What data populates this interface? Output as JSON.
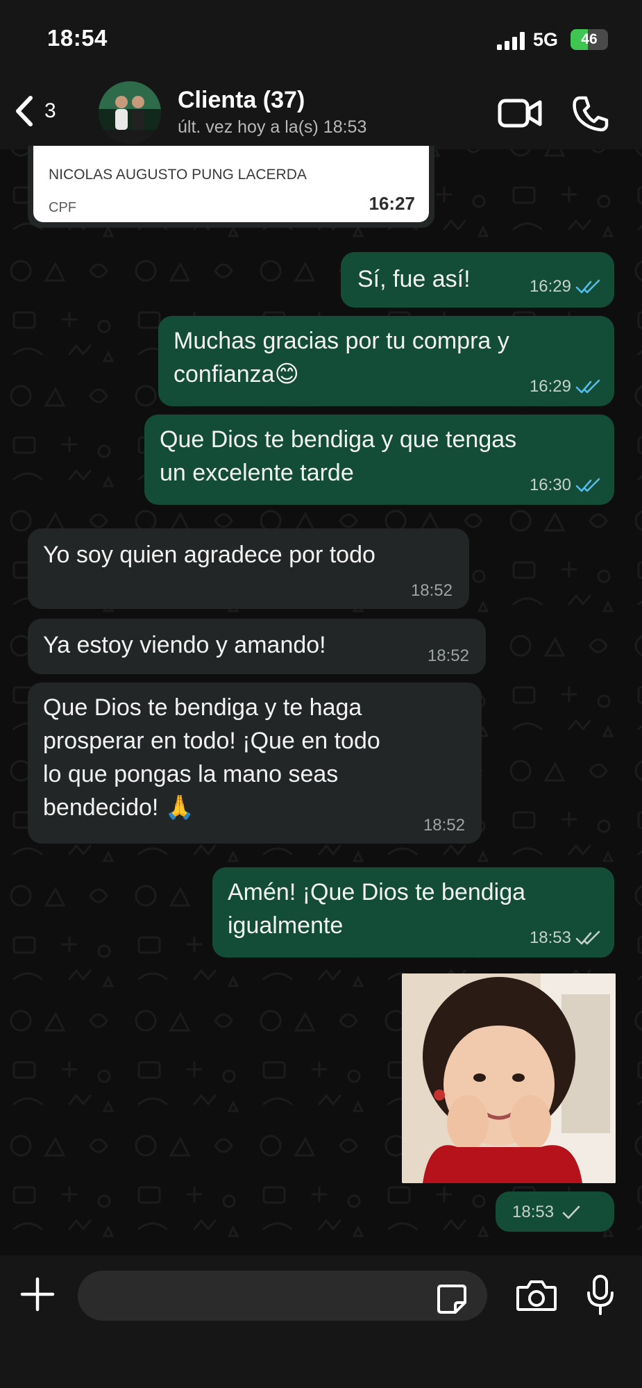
{
  "status_bar": {
    "time": "18:54",
    "network": "5G",
    "battery": "46",
    "battery_level": 0.46
  },
  "header": {
    "back_count": "3",
    "contact_name": "Clienta (37)",
    "last_seen": "últ. vez hoy a la(s) 18:53"
  },
  "forwarded_card": {
    "name": "NICOLAS AUGUSTO PUNG LACERDA",
    "label": "CPF",
    "time": "16:27"
  },
  "messages": [
    {
      "dir": "out",
      "text": "Sí, fue así!",
      "time": "16:29",
      "status": "read"
    },
    {
      "dir": "out",
      "text": "Muchas gracias por tu compra y confianza😊",
      "time": "16:29",
      "status": "read"
    },
    {
      "dir": "out",
      "text": "Que Dios te bendiga y que tengas un excelente tarde",
      "time": "16:30",
      "status": "read"
    },
    {
      "dir": "in",
      "text": "Yo soy quien agradece por todo",
      "time": "18:52"
    },
    {
      "dir": "in",
      "text": "Ya estoy viendo y amando!",
      "time": "18:52"
    },
    {
      "dir": "in",
      "text": "Que Dios te bendiga y te haga prosperar en todo! ¡Que en todo lo que pongas la mano seas bendecido! 🙏",
      "time": "18:52"
    },
    {
      "dir": "out",
      "text": "Amén! ¡Que Dios te bendiga igualmente",
      "time": "18:53",
      "status": "delivered"
    },
    {
      "dir": "out",
      "type": "image",
      "time": "18:53",
      "status": "sent"
    }
  ],
  "message_lines": {
    "m1": [
      "Sí, fue así!"
    ],
    "m2": [
      "Muchas gracias por tu compra y",
      "confianza😊"
    ],
    "m3": [
      "Que Dios te bendiga y que tengas",
      "un excelente tarde"
    ],
    "m4": [
      "Yo soy quien agradece por todo"
    ],
    "m5": [
      "Ya estoy viendo y amando!"
    ],
    "m6": [
      "Que Dios te bendiga y te haga",
      "prosperar en todo! ¡Que en todo",
      "lo que pongas la mano seas",
      "bendecido! 🙏"
    ],
    "m7": [
      "Amén! ¡Que Dios te bendiga",
      "igualmente"
    ]
  },
  "colors": {
    "outgoing_bubble": "#144d37",
    "incoming_bubble": "#232626",
    "read_tick": "#53bdeb",
    "delivered_tick": "#c5d2cc",
    "battery_green": "#3fc652"
  },
  "icons": {
    "back": "chevron-left-icon",
    "video": "video-camera-icon",
    "call": "phone-icon",
    "plus": "plus-icon",
    "sticker": "sticker-icon",
    "camera": "camera-icon",
    "mic": "microphone-icon"
  }
}
